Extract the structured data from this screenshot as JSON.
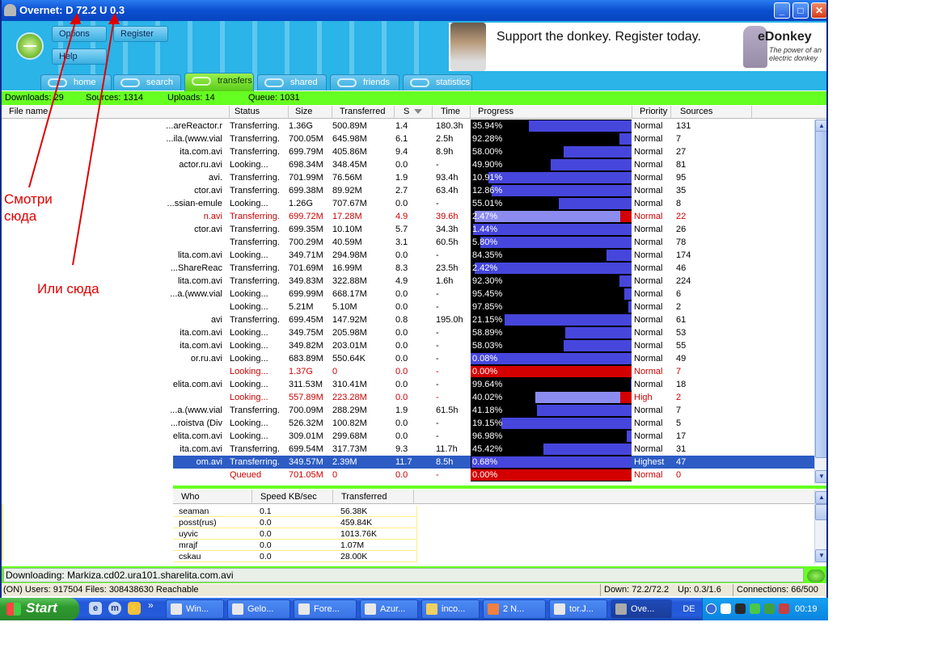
{
  "window": {
    "title": "Overnet: D 72.2 U 0.3",
    "buttons": {
      "minimize": "_",
      "maximize": "□",
      "close": "✕"
    }
  },
  "toolbar": {
    "options": "Options",
    "register": "Register",
    "help": "Help"
  },
  "banner": {
    "message": "Support the donkey. Register today.",
    "brand": "eDonkey",
    "tagline": "The power of an electric donkey"
  },
  "tabs": [
    {
      "label": "home",
      "icon": "home-icon"
    },
    {
      "label": "search",
      "icon": "search-icon"
    },
    {
      "label": "transfers",
      "icon": "transfers-icon",
      "active": true
    },
    {
      "label": "shared",
      "icon": "shared-icon"
    },
    {
      "label": "friends",
      "icon": "friends-icon"
    },
    {
      "label": "statistics",
      "icon": "statistics-icon"
    }
  ],
  "summary": {
    "downloads": "Downloads: 29",
    "sources": "Sources: 1314",
    "uploads": "Uploads: 14",
    "queue": "Queue: 1031"
  },
  "columns": {
    "filename": "File name",
    "status": "Status",
    "size": "Size",
    "transferred": "Transferred",
    "speed": "S",
    "time": "Time",
    "progress": "Progress",
    "priority": "Priority",
    "sources": "Sources"
  },
  "transfers": [
    {
      "name": "areReactor.r...",
      "status": "Transferring.",
      "size": "1.36G",
      "transferred": "500.89M",
      "speed": "1.4",
      "time": "180.3h",
      "progress": "35.94%",
      "fraction": 0.6406,
      "priority": "Normal",
      "sources": "131"
    },
    {
      "name": "ila.(www.vial...",
      "status": "Transferring.",
      "size": "700.05M",
      "transferred": "645.98M",
      "speed": "6.1",
      "time": "2.5h",
      "progress": "92.28%",
      "fraction": 0.0772,
      "priority": "Normal",
      "sources": "7"
    },
    {
      "name": "ita.com.avi",
      "status": "Transferring.",
      "size": "699.79M",
      "transferred": "405.86M",
      "speed": "9.4",
      "time": "8.9h",
      "progress": "58.00%",
      "fraction": 0.42,
      "priority": "Normal",
      "sources": "27"
    },
    {
      "name": "actor.ru.avi",
      "status": "Looking...",
      "size": "698.34M",
      "transferred": "348.45M",
      "speed": "0.0",
      "time": "-",
      "progress": "49.90%",
      "fraction": 0.501,
      "priority": "Normal",
      "sources": "81"
    },
    {
      "name": ".avi",
      "status": "Transferring.",
      "size": "701.99M",
      "transferred": "76.56M",
      "speed": "1.9",
      "time": "93.4h",
      "progress": "10.91%",
      "fraction": 0.8909,
      "priority": "Normal",
      "sources": "95"
    },
    {
      "name": "ctor.avi",
      "status": "Transferring.",
      "size": "699.38M",
      "transferred": "89.92M",
      "speed": "2.7",
      "time": "63.4h",
      "progress": "12.86%",
      "fraction": 0.8714,
      "priority": "Normal",
      "sources": "35"
    },
    {
      "name": "ssian-emule...",
      "status": "Looking...",
      "size": "1.26G",
      "transferred": "707.67M",
      "speed": "0.0",
      "time": "-",
      "progress": "55.01%",
      "fraction": 0.4499,
      "priority": "Normal",
      "sources": "8"
    },
    {
      "name": "n.avi",
      "status": "Transferring.",
      "size": "699.72M",
      "transferred": "17.28M",
      "speed": "4.9",
      "time": "39.6h",
      "progress": "2.47%",
      "fraction": 0.9753,
      "priority": "Normal",
      "sources": "22",
      "red": true
    },
    {
      "name": "ctor.avi",
      "status": "Transferring.",
      "size": "699.35M",
      "transferred": "10.10M",
      "speed": "5.7",
      "time": "34.3h",
      "progress": "1.44%",
      "fraction": 0.9856,
      "priority": "Normal",
      "sources": "26"
    },
    {
      "name": "",
      "status": "Transferring.",
      "size": "700.29M",
      "transferred": "40.59M",
      "speed": "3.1",
      "time": "60.5h",
      "progress": "5.80%",
      "fraction": 0.942,
      "priority": "Normal",
      "sources": "78"
    },
    {
      "name": "lita.com.avi",
      "status": "Looking...",
      "size": "349.71M",
      "transferred": "294.98M",
      "speed": "0.0",
      "time": "-",
      "progress": "84.35%",
      "fraction": 0.1565,
      "priority": "Normal",
      "sources": "174"
    },
    {
      "name": "ShareReac...",
      "status": "Transferring.",
      "size": "701.69M",
      "transferred": "16.99M",
      "speed": "8.3",
      "time": "23.5h",
      "progress": "2.42%",
      "fraction": 0.9758,
      "priority": "Normal",
      "sources": "46"
    },
    {
      "name": "lita.com.avi",
      "status": "Transferring.",
      "size": "349.83M",
      "transferred": "322.88M",
      "speed": "4.9",
      "time": "1.6h",
      "progress": "92.30%",
      "fraction": 0.077,
      "priority": "Normal",
      "sources": "224"
    },
    {
      "name": "a.(www.vial...",
      "status": "Looking...",
      "size": "699.99M",
      "transferred": "668.17M",
      "speed": "0.0",
      "time": "-",
      "progress": "95.45%",
      "fraction": 0.0455,
      "priority": "Normal",
      "sources": "6"
    },
    {
      "name": "",
      "status": "Looking...",
      "size": "5.21M",
      "transferred": "5.10M",
      "speed": "0.0",
      "time": "-",
      "progress": "97.85%",
      "fraction": 0.0215,
      "priority": "Normal",
      "sources": "2"
    },
    {
      "name": "avi",
      "status": "Transferring.",
      "size": "699.45M",
      "transferred": "147.92M",
      "speed": "0.8",
      "time": "195.0h",
      "progress": "21.15%",
      "fraction": 0.7885,
      "priority": "Normal",
      "sources": "61"
    },
    {
      "name": "ita.com.avi",
      "status": "Looking...",
      "size": "349.75M",
      "transferred": "205.98M",
      "speed": "0.0",
      "time": "-",
      "progress": "58.89%",
      "fraction": 0.4111,
      "priority": "Normal",
      "sources": "53"
    },
    {
      "name": "ita.com.avi",
      "status": "Looking...",
      "size": "349.82M",
      "transferred": "203.01M",
      "speed": "0.0",
      "time": "-",
      "progress": "58.03%",
      "fraction": 0.4197,
      "priority": "Normal",
      "sources": "55"
    },
    {
      "name": "or.ru.avi",
      "status": "Looking...",
      "size": "683.89M",
      "transferred": "550.64K",
      "speed": "0.0",
      "time": "-",
      "progress": "0.08%",
      "fraction": 0.9992,
      "priority": "Normal",
      "sources": "49"
    },
    {
      "name": "",
      "status": "Looking...",
      "size": "1.37G",
      "transferred": "0",
      "speed": "0.0",
      "time": "-",
      "progress": "0.00%",
      "fraction": 1.0,
      "priority": "Normal",
      "sources": "7",
      "red": true
    },
    {
      "name": "elita.com.avi",
      "status": "Looking...",
      "size": "311.53M",
      "transferred": "310.41M",
      "speed": "0.0",
      "time": "-",
      "progress": "99.64%",
      "fraction": 0.0036,
      "priority": "Normal",
      "sources": "18"
    },
    {
      "name": "",
      "status": "Looking...",
      "size": "557.89M",
      "transferred": "223.28M",
      "speed": "0.0",
      "time": "-",
      "progress": "40.02%",
      "fraction": 0.5998,
      "priority": "High",
      "sources": "2",
      "red": true
    },
    {
      "name": "a.(www.vial...",
      "status": "Transferring.",
      "size": "700.09M",
      "transferred": "288.29M",
      "speed": "1.9",
      "time": "61.5h",
      "progress": "41.18%",
      "fraction": 0.5882,
      "priority": "Normal",
      "sources": "7"
    },
    {
      "name": "roistva (Div...",
      "status": "Looking...",
      "size": "526.32M",
      "transferred": "100.82M",
      "speed": "0.0",
      "time": "-",
      "progress": "19.15%",
      "fraction": 0.8085,
      "priority": "Normal",
      "sources": "5"
    },
    {
      "name": "elita.com.avi",
      "status": "Looking...",
      "size": "309.01M",
      "transferred": "299.68M",
      "speed": "0.0",
      "time": "-",
      "progress": "96.98%",
      "fraction": 0.0302,
      "priority": "Normal",
      "sources": "17"
    },
    {
      "name": "ita.com.avi",
      "status": "Transferring.",
      "size": "699.54M",
      "transferred": "317.73M",
      "speed": "9.3",
      "time": "11.7h",
      "progress": "45.42%",
      "fraction": 0.5458,
      "priority": "Normal",
      "sources": "31"
    },
    {
      "name": "om.avi",
      "status": "Transferring.",
      "size": "349.57M",
      "transferred": "2.39M",
      "speed": "11.7",
      "time": "8.5h",
      "progress": "0.68%",
      "fraction": 0.9932,
      "priority": "Highest",
      "sources": "47",
      "selected": true
    },
    {
      "name": "",
      "status": "Queued",
      "size": "701.05M",
      "transferred": "0",
      "speed": "0.0",
      "time": "-",
      "progress": "0.00%",
      "fraction": 1.0,
      "priority": "Normal",
      "sources": "0",
      "red": true
    }
  ],
  "uploads_columns": {
    "who": "Who",
    "speed": "Speed KB/sec",
    "transferred": "Transferred"
  },
  "uploads": [
    {
      "who": "seaman",
      "speed": "0.1",
      "transferred": "56.38K"
    },
    {
      "who": "posst(rus)",
      "speed": "0.0",
      "transferred": "459.84K"
    },
    {
      "who": "uyvic",
      "speed": "0.0",
      "transferred": "1013.76K"
    },
    {
      "who": "mrajf",
      "speed": "0.0",
      "transferred": "1.07M"
    },
    {
      "who": "cskau",
      "speed": "0.0",
      "transferred": "28.00K"
    }
  ],
  "downloading": "Downloading: Markiza.cd02.ura101.sharelita.com.avi",
  "statusbar": {
    "left": "(ON) Users: 917504 Files: 308438630 Reachable",
    "down": "Down: 72.2/72.2",
    "up": "Up: 0.3/1.6",
    "connections": "Connections: 66/500"
  },
  "taskbar": {
    "start": "Start",
    "quick_launch_chevron": "»",
    "items": [
      {
        "label": "Win...",
        "active": false
      },
      {
        "label": "Gelo...",
        "active": false
      },
      {
        "label": "Fore...",
        "active": false
      },
      {
        "label": "Azur...",
        "active": false
      },
      {
        "label": "inco...",
        "active": false
      },
      {
        "label": "2 N...",
        "active": false
      },
      {
        "label": "tor.J...",
        "active": false
      },
      {
        "label": "Ove...",
        "active": true
      }
    ],
    "language": "DE",
    "clock": "00:19"
  },
  "annotations": {
    "look_here": "Смотри сюда",
    "or_here": "Или сюда"
  },
  "colors": {
    "progress_blue": "#4646dc",
    "progress_light": "#8c8cf0",
    "progress_red": "#d20000",
    "accent_green": "#66ff22",
    "arrow_red": "#e00000"
  }
}
